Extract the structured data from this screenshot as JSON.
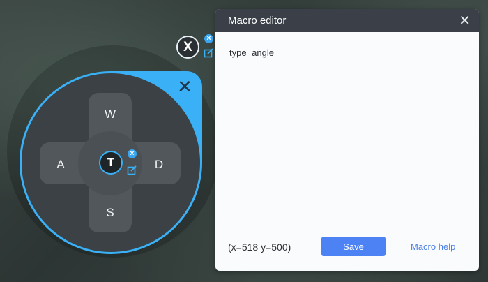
{
  "overlay": {
    "top_key_label": "X",
    "center_key_label": "T",
    "directions": {
      "up": "W",
      "left": "A",
      "right": "D",
      "down": "S"
    },
    "accent_color": "#3ab1f7"
  },
  "macro_editor": {
    "title": "Macro editor",
    "content": "type=angle",
    "coordinates": "(x=518  y=500)",
    "save_label": "Save",
    "help_label": "Macro help"
  }
}
